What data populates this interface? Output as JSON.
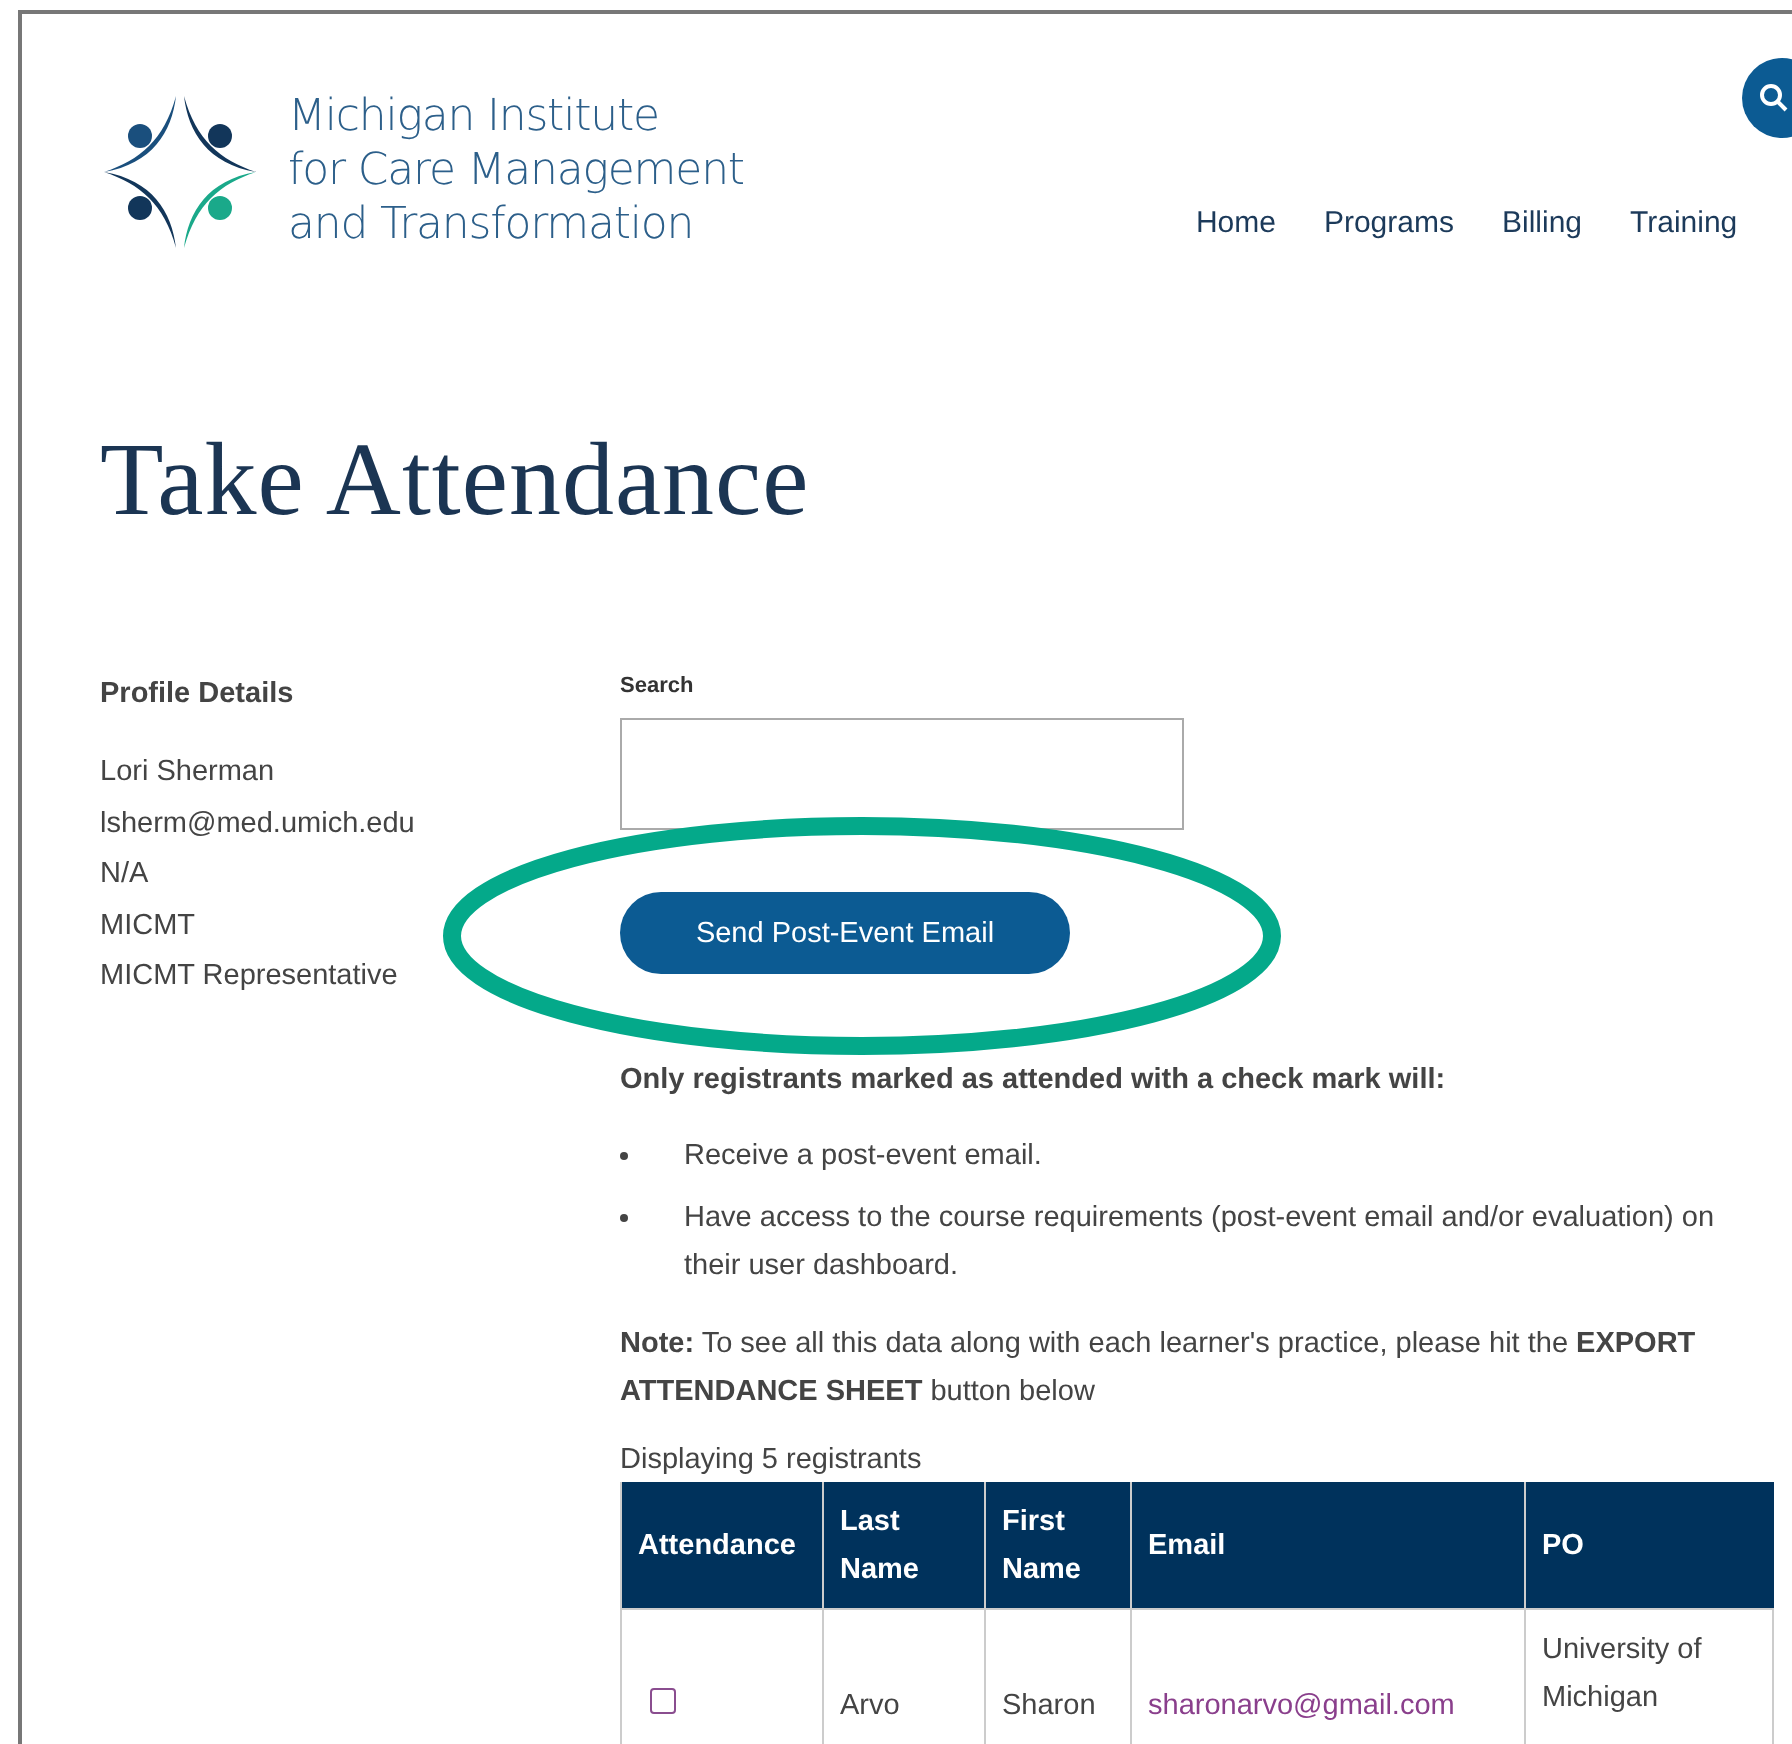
{
  "logo": {
    "lines": [
      "Michigan Institute",
      "for Care Management",
      "and Transformation"
    ]
  },
  "nav": [
    "Home",
    "Programs",
    "Billing",
    "Training"
  ],
  "page_title": "Take Attendance",
  "profile": {
    "heading": "Profile Details",
    "lines": [
      "Lori Sherman",
      "lsherm@med.umich.edu",
      "N/A",
      "MICMT",
      "MICMT Representative"
    ]
  },
  "search": {
    "label": "Search"
  },
  "send_button": "Send Post-Event Email",
  "intro": "Only registrants marked as attended with a check mark will:",
  "bullets": [
    "Receive a post-event email.",
    "Have access to the course requirements (post-event email and/or evaluation) on their user dashboard."
  ],
  "note": "**Note:** To see all this data along with each learner's practice, please hit the **EXPORT ATTENDANCE SHEET** button below",
  "count": "Displaying 5 registrants",
  "table": {
    "columns": [
      "Attendance",
      "Last Name",
      "First Name",
      "Email",
      "PO"
    ],
    "rows": [
      {
        "attended": false,
        "last_name": "Arvo",
        "first_name": "Sharon",
        "email": "sharonarvo@gmail.com",
        "po": "University of Michigan"
      }
    ]
  }
}
